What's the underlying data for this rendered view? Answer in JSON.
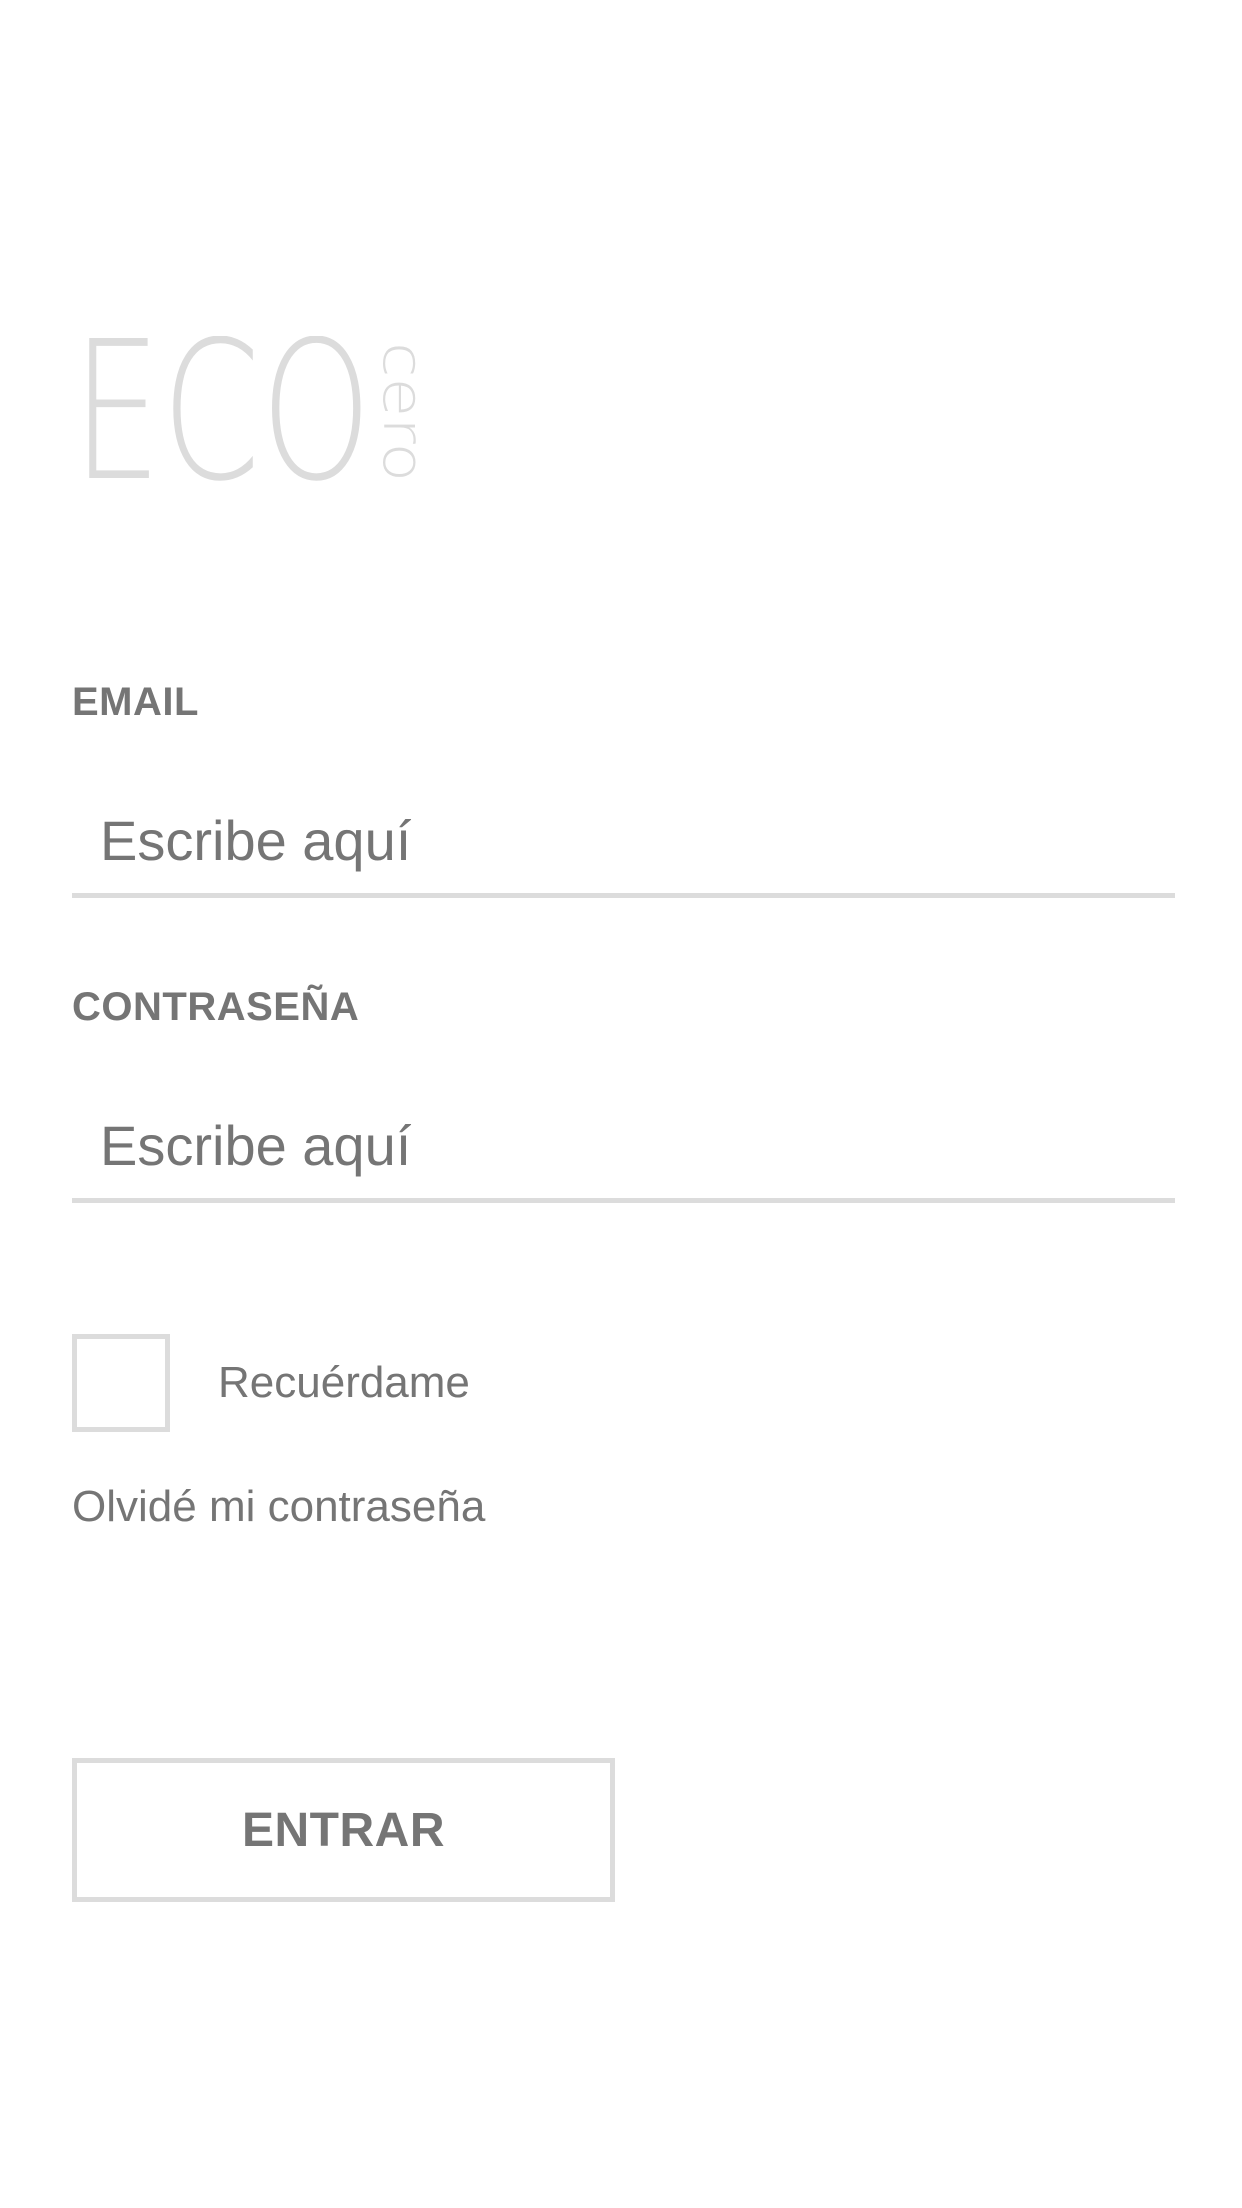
{
  "logo": {
    "main_text": "ECO",
    "side_text": "cero",
    "color": "#dcdcdc"
  },
  "form": {
    "email": {
      "label": "EMAIL",
      "placeholder": "Escribe aquí",
      "value": ""
    },
    "password": {
      "label": "CONTRASEÑA",
      "placeholder": "Escribe aquí",
      "value": ""
    },
    "remember": {
      "label": "Recuérdame",
      "checked": false
    },
    "forgot_label": "Olvidé mi contraseña",
    "submit_label": "ENTRAR"
  },
  "colors": {
    "text": "#757575",
    "border": "#dcdcdc",
    "background": "#ffffff"
  }
}
